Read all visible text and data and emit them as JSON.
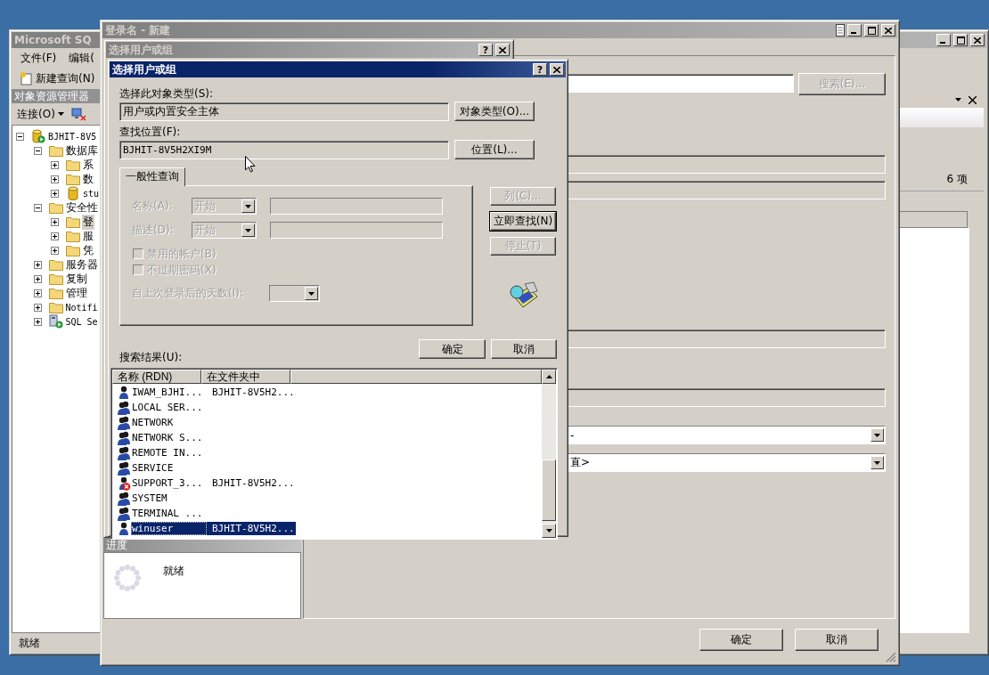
{
  "ssms": {
    "title": "Microsoft SQ",
    "menu": [
      "文件(F)",
      "编辑("
    ],
    "toolbar": {
      "new_query": "新建查询(N)"
    },
    "object_explorer": {
      "title": "对象资源管理器",
      "connect": "连接(O)",
      "tree": [
        {
          "label": "BJHIT-8V5",
          "kind": "server",
          "expanded": true,
          "selected": false,
          "children": [
            {
              "label": "数据库",
              "kind": "folder",
              "expanded": true,
              "selected": false,
              "children": [
                {
                  "label": "系",
                  "kind": "folder",
                  "expanded": false,
                  "selected": false
                },
                {
                  "label": "数",
                  "kind": "folder",
                  "expanded": false,
                  "selected": false
                },
                {
                  "label": "stu",
                  "kind": "database",
                  "expanded": false,
                  "selected": false
                }
              ]
            },
            {
              "label": "安全性",
              "kind": "folder",
              "expanded": true,
              "selected": false,
              "children": [
                {
                  "label": "登",
                  "kind": "folder",
                  "expanded": false,
                  "selected": true
                },
                {
                  "label": "服",
                  "kind": "folder",
                  "expanded": false,
                  "selected": false
                },
                {
                  "label": "凭",
                  "kind": "folder",
                  "expanded": false,
                  "selected": false
                }
              ]
            },
            {
              "label": "服务器",
              "kind": "folder",
              "expanded": false,
              "selected": false
            },
            {
              "label": "复制",
              "kind": "folder",
              "expanded": false,
              "selected": false
            },
            {
              "label": "管理",
              "kind": "folder",
              "expanded": false,
              "selected": false
            },
            {
              "label": "Notifi",
              "kind": "folder",
              "expanded": false,
              "selected": false
            },
            {
              "label": "SQL Se",
              "kind": "agent",
              "expanded": false,
              "selected": false
            }
          ]
        }
      ]
    },
    "summary": {
      "count": "6 项"
    },
    "status": "就绪"
  },
  "login_window": {
    "title": "登录名 - 新建",
    "search_button": {
      "label": "搜索(E)...",
      "disabled": true
    },
    "dropdowns": [
      {
        "value": "-"
      },
      {
        "value": "直>"
      }
    ],
    "progress": {
      "title": "进度",
      "status": "就绪"
    },
    "buttons": [
      "确定",
      "取消"
    ]
  },
  "back_dialog": {
    "title": "选择用户或组",
    "help_button": "?"
  },
  "dialog": {
    "title": "选择用户或组",
    "help_button": "?",
    "object_type": {
      "label": "选择此对象类型(S):",
      "value": "用户或内置安全主体",
      "button": "对象类型(O)..."
    },
    "location": {
      "label": "查找位置(F):",
      "value": "BJHIT-8V5H2XI9M",
      "button": "位置(L)..."
    },
    "tab": {
      "label": "一般性查询",
      "selected": true
    },
    "query": {
      "disabled": true,
      "rows": [
        {
          "label": "名称(A):",
          "mode": "开始"
        },
        {
          "label": "描述(D):",
          "mode": "开始"
        }
      ],
      "checkboxes": [
        {
          "label": "禁用的帐户(B)",
          "checked": false
        },
        {
          "label": "不过期密码(X)",
          "checked": false
        }
      ],
      "days_label": "自上次登录后的天数(I):"
    },
    "side_buttons": [
      {
        "label": "列(C)...",
        "disabled": true,
        "default": false
      },
      {
        "label": "立即查找(N)",
        "disabled": false,
        "default": true
      },
      {
        "label": "停止(T)",
        "disabled": true,
        "default": false
      }
    ],
    "buttons": [
      "确定",
      "取消"
    ],
    "results_label": "搜索结果(U):",
    "results": {
      "columns": [
        "名称 (RDN)",
        "在文件夹中"
      ],
      "rows": [
        {
          "name": "IWAM_BJHI...",
          "folder": "BJHIT-8V5H2...",
          "kind": "user",
          "selected": false
        },
        {
          "name": "LOCAL SER...",
          "kind": "group",
          "selected": false
        },
        {
          "name": "NETWORK",
          "kind": "group",
          "selected": false
        },
        {
          "name": "NETWORK S...",
          "kind": "group",
          "selected": false
        },
        {
          "name": "REMOTE IN...",
          "kind": "group",
          "selected": false
        },
        {
          "name": "SERVICE",
          "kind": "group",
          "selected": false
        },
        {
          "name": "SUPPORT_3...",
          "folder": "BJHIT-8V5H2...",
          "kind": "user-disabled",
          "selected": false
        },
        {
          "name": "SYSTEM",
          "kind": "group",
          "selected": false
        },
        {
          "name": "TERMINAL ...",
          "kind": "group",
          "selected": false
        },
        {
          "name": "winuser",
          "folder": "BJHIT-8V5H2...",
          "kind": "user",
          "selected": true
        }
      ]
    }
  }
}
